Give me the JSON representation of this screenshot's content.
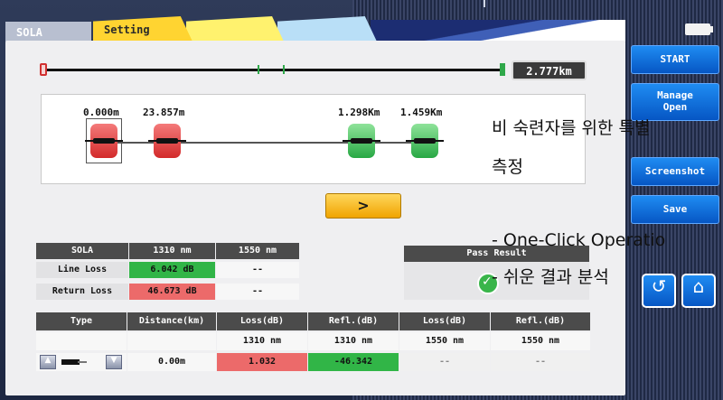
{
  "tabs": [
    "SOLA",
    "Setting"
  ],
  "distance": {
    "total": "2.777km"
  },
  "events": [
    {
      "label": "0.000m",
      "color": "red",
      "selected": true
    },
    {
      "label": "23.857m",
      "color": "red",
      "selected": false
    },
    {
      "label": "1.298Km",
      "color": "green",
      "selected": false
    },
    {
      "label": "1.459Km",
      "color": "green",
      "selected": false
    }
  ],
  "next_button": {
    "label": ">"
  },
  "summary_table": {
    "headers": [
      "SOLA",
      "1310 nm",
      "1550 nm"
    ],
    "rows": [
      {
        "label": "Line Loss",
        "v1310": "6.042 dB",
        "v1550": "--"
      },
      {
        "label": "Return Loss",
        "v1310": "46.673 dB",
        "v1550": "--"
      }
    ],
    "pass_result_header": "Pass Result"
  },
  "event_table": {
    "headers": [
      "Type",
      "Distance(km)",
      "Loss(dB)",
      "Refl.(dB)",
      "Loss(dB)",
      "Refl.(dB)"
    ],
    "subheaders": [
      "",
      "",
      "1310 nm",
      "1310 nm",
      "1550 nm",
      "1550 nm"
    ],
    "row": {
      "distance": "0.00m",
      "loss1310": "1.032",
      "refl1310": "-46.342",
      "loss1550": "--",
      "refl1550": "--"
    }
  },
  "side_buttons": {
    "start": "START",
    "manage": "Manage",
    "open": "Open",
    "screenshot": "Screenshot",
    "save": "Save"
  },
  "overlay_text": {
    "line1": "비 숙련자를 위한 특별",
    "line2": "측정",
    "line3": "- One-Click Operatio",
    "line4": "- 쉬운 결과 분석"
  },
  "colors": {
    "accent_blue": "#0a6fe0",
    "tab_yellow": "#ffd431",
    "pass_green": "#31b547",
    "fail_red": "#ec6a6a"
  }
}
